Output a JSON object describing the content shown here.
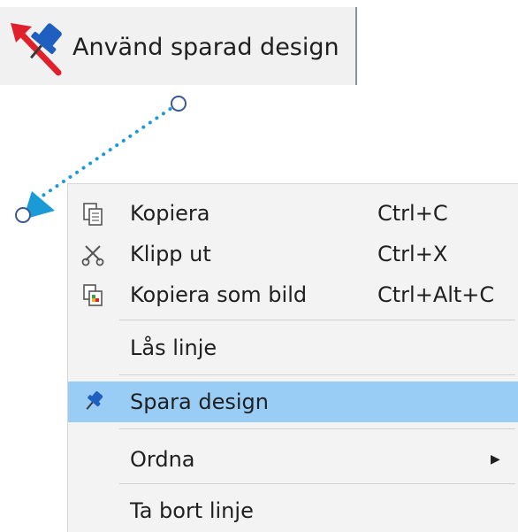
{
  "toolbar": {
    "apply_saved_design": {
      "label": "Använd sparad design",
      "icon": "pin-arrow-icon"
    }
  },
  "line": {
    "color": "#1a9bd7",
    "style": "dotted",
    "start_marker": "arrowhead",
    "end_marker": "circle-handle"
  },
  "context_menu": {
    "items": [
      {
        "label": "Kopiera",
        "shortcut": "Ctrl+C",
        "icon": "copy-icon"
      },
      {
        "label": "Klipp ut",
        "shortcut": "Ctrl+X",
        "icon": "scissors-icon"
      },
      {
        "label": "Kopiera som bild",
        "shortcut": "Ctrl+Alt+C",
        "icon": "copy-as-image-icon"
      },
      {
        "label": "Lås linje"
      },
      {
        "label": "Spara design",
        "icon": "pin-icon",
        "highlighted": true
      },
      {
        "label": "Ordna",
        "submenu": true
      },
      {
        "label": "Ta bort linje"
      }
    ],
    "highlight_color": "#99cdf6"
  }
}
